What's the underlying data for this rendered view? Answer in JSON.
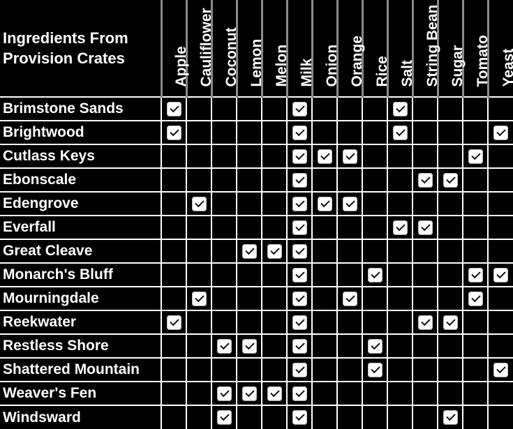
{
  "table": {
    "title": "Ingredients From Provision Crates",
    "columns": [
      "Apple",
      "Cauliflower",
      "Coconut",
      "Lemon",
      "Melon",
      "Milk",
      "Onion",
      "Orange",
      "Rice",
      "Salt",
      "String Bean",
      "Sugar",
      "Tomato",
      "Yeast"
    ],
    "rows": [
      {
        "name": "Brimstone Sands",
        "ingredients": [
          "Apple",
          "Milk",
          "Salt"
        ]
      },
      {
        "name": "Brightwood",
        "ingredients": [
          "Apple",
          "Milk",
          "Salt",
          "Yeast"
        ]
      },
      {
        "name": "Cutlass Keys",
        "ingredients": [
          "Milk",
          "Onion",
          "Orange",
          "Tomato"
        ]
      },
      {
        "name": "Ebonscale",
        "ingredients": [
          "Milk",
          "String Bean",
          "Sugar"
        ]
      },
      {
        "name": "Edengrove",
        "ingredients": [
          "Cauliflower",
          "Milk",
          "Onion",
          "Orange"
        ]
      },
      {
        "name": "Everfall",
        "ingredients": [
          "Milk",
          "Salt",
          "String Bean"
        ]
      },
      {
        "name": "Great Cleave",
        "ingredients": [
          "Lemon",
          "Melon",
          "Milk"
        ]
      },
      {
        "name": "Monarch's Bluff",
        "ingredients": [
          "Milk",
          "Rice",
          "Tomato",
          "Yeast"
        ]
      },
      {
        "name": "Mourningdale",
        "ingredients": [
          "Cauliflower",
          "Milk",
          "Orange",
          "Tomato"
        ]
      },
      {
        "name": "Reekwater",
        "ingredients": [
          "Apple",
          "Milk",
          "String Bean",
          "Sugar"
        ]
      },
      {
        "name": "Restless Shore",
        "ingredients": [
          "Coconut",
          "Lemon",
          "Milk",
          "Rice"
        ]
      },
      {
        "name": "Shattered Mountain",
        "ingredients": [
          "Milk",
          "Rice",
          "Yeast"
        ]
      },
      {
        "name": "Weaver's Fen",
        "ingredients": [
          "Coconut",
          "Lemon",
          "Melon",
          "Milk"
        ]
      },
      {
        "name": "Windsward",
        "ingredients": [
          "Coconut",
          "Milk",
          "Sugar"
        ]
      }
    ]
  },
  "icons": {
    "check": "checkmark-icon"
  },
  "colors": {
    "background": "#000000",
    "text": "#ffffff",
    "grid": "#ffffff",
    "header_divider": "#8a8a8a",
    "checkbox": "#ffffff"
  }
}
